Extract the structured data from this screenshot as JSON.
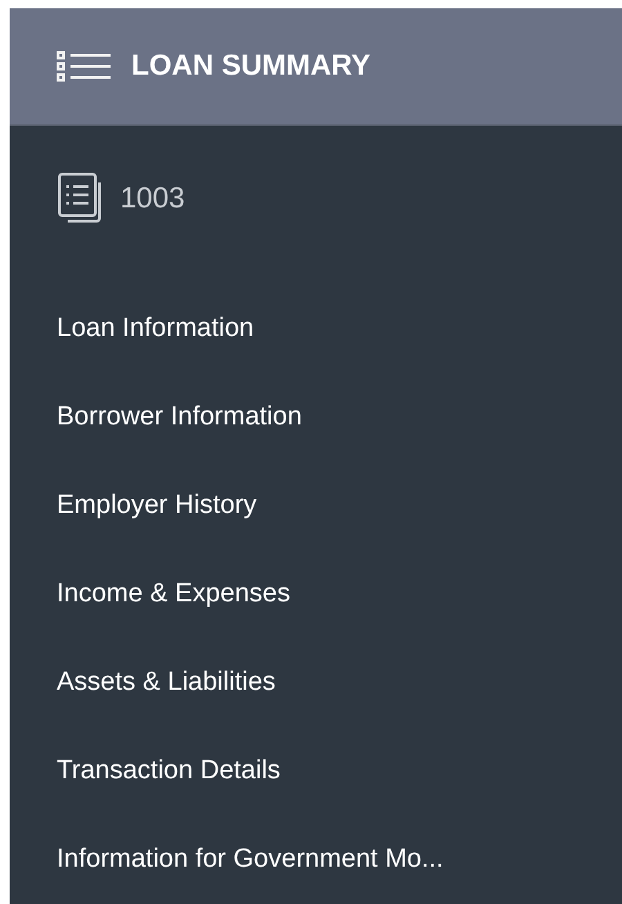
{
  "header": {
    "title": "LOAN SUMMARY"
  },
  "form": {
    "label": "1003"
  },
  "sections": [
    {
      "label": "Loan Information"
    },
    {
      "label": "Borrower Information"
    },
    {
      "label": "Employer History"
    },
    {
      "label": "Income & Expenses"
    },
    {
      "label": "Assets & Liabilities"
    },
    {
      "label": "Transaction Details"
    },
    {
      "label": "Information for Government Mo..."
    }
  ]
}
